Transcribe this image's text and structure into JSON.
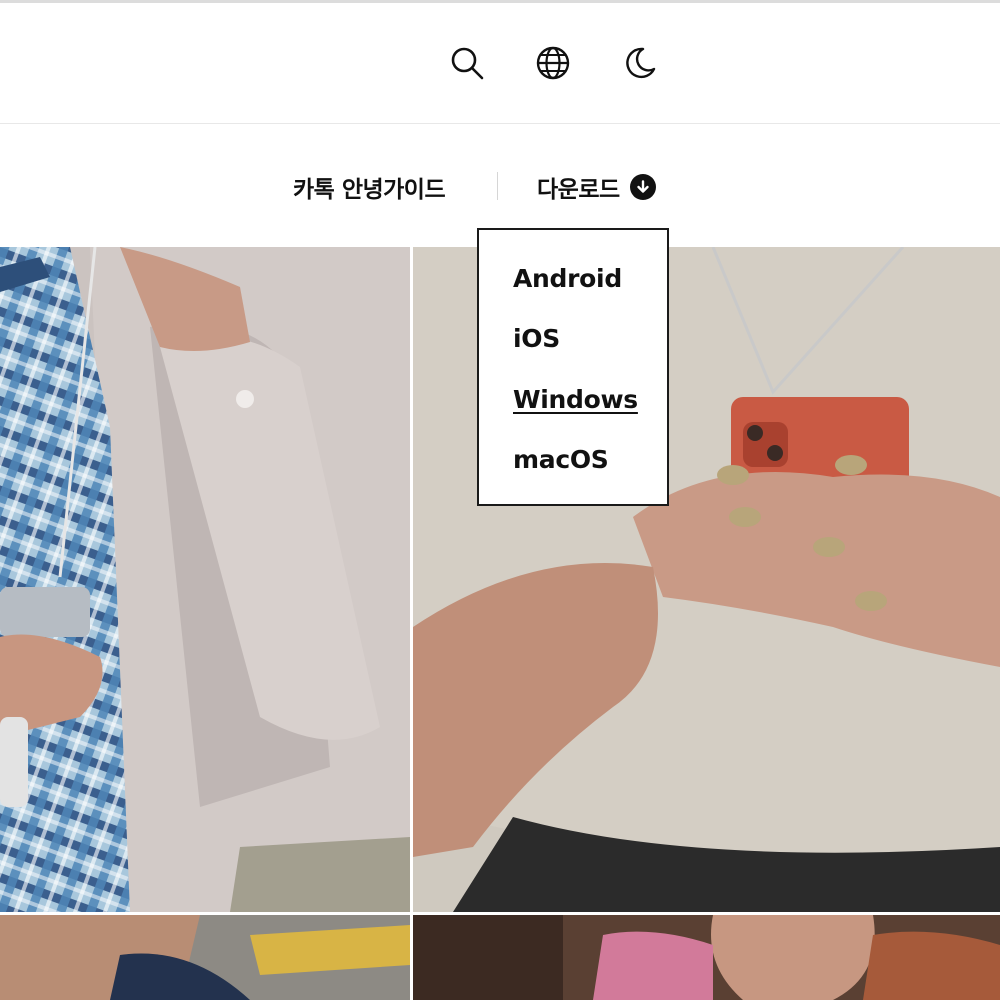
{
  "header": {
    "icons": [
      "search-icon",
      "globe-icon",
      "moon-icon"
    ]
  },
  "nav": {
    "guide_label": "카톡 안녕가이드",
    "download_label": "다운로드",
    "download_icon": "arrow-down-circle-icon"
  },
  "download_menu": {
    "items": [
      {
        "label": "Android"
      },
      {
        "label": "iOS"
      },
      {
        "label": "Windows",
        "active": true
      },
      {
        "label": "macOS"
      }
    ]
  },
  "colors": {
    "text": "#111111",
    "border": "#1a1a1a",
    "divider": "#d6d6d6",
    "background": "#ffffff"
  }
}
